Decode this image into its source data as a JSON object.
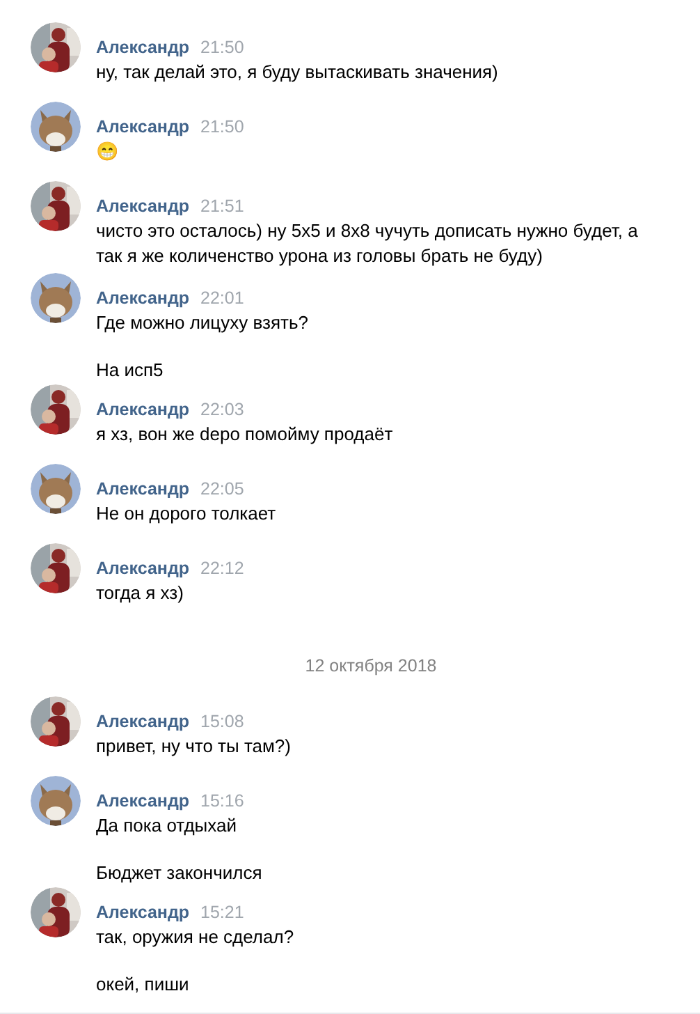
{
  "messages": [
    {
      "kind": "message",
      "author": "Александр",
      "time": "21:50",
      "paragraphs": [
        "ну, так делай это, я буду вытаскивать значения)"
      ]
    },
    {
      "kind": "message",
      "author": "Александр",
      "time": "21:50",
      "paragraphs": [
        "😁"
      ]
    },
    {
      "kind": "message",
      "author": "Александр",
      "time": "21:51",
      "paragraphs": [
        "чисто это осталось) ну 5х5 и 8х8 чучуть дописать нужно будет, а так я же количенство урона из головы брать не буду)"
      ]
    },
    {
      "kind": "message",
      "author": "Александр",
      "time": "22:01",
      "paragraphs": [
        "Где можно лицуху взять?",
        "На исп5"
      ]
    },
    {
      "kind": "message",
      "author": "Александр",
      "time": "22:03",
      "paragraphs": [
        "я хз, вон же depo помойму продаёт"
      ]
    },
    {
      "kind": "message",
      "author": "Александр",
      "time": "22:05",
      "paragraphs": [
        "Не он дорого толкает"
      ]
    },
    {
      "kind": "message",
      "author": "Александр",
      "time": "22:12",
      "paragraphs": [
        "тогда я хз)"
      ]
    },
    {
      "kind": "date",
      "text": "12 октября 2018"
    },
    {
      "kind": "message",
      "author": "Александр",
      "time": "15:08",
      "paragraphs": [
        "привет, ну что ты там?)"
      ]
    },
    {
      "kind": "message",
      "author": "Александр",
      "time": "15:16",
      "paragraphs": [
        "Да пока отдыхай",
        "Бюджет закончился"
      ]
    },
    {
      "kind": "message",
      "author": "Александр",
      "time": "15:21",
      "paragraphs": [
        "так, оружия не сделал?",
        "окей, пиши"
      ]
    }
  ]
}
